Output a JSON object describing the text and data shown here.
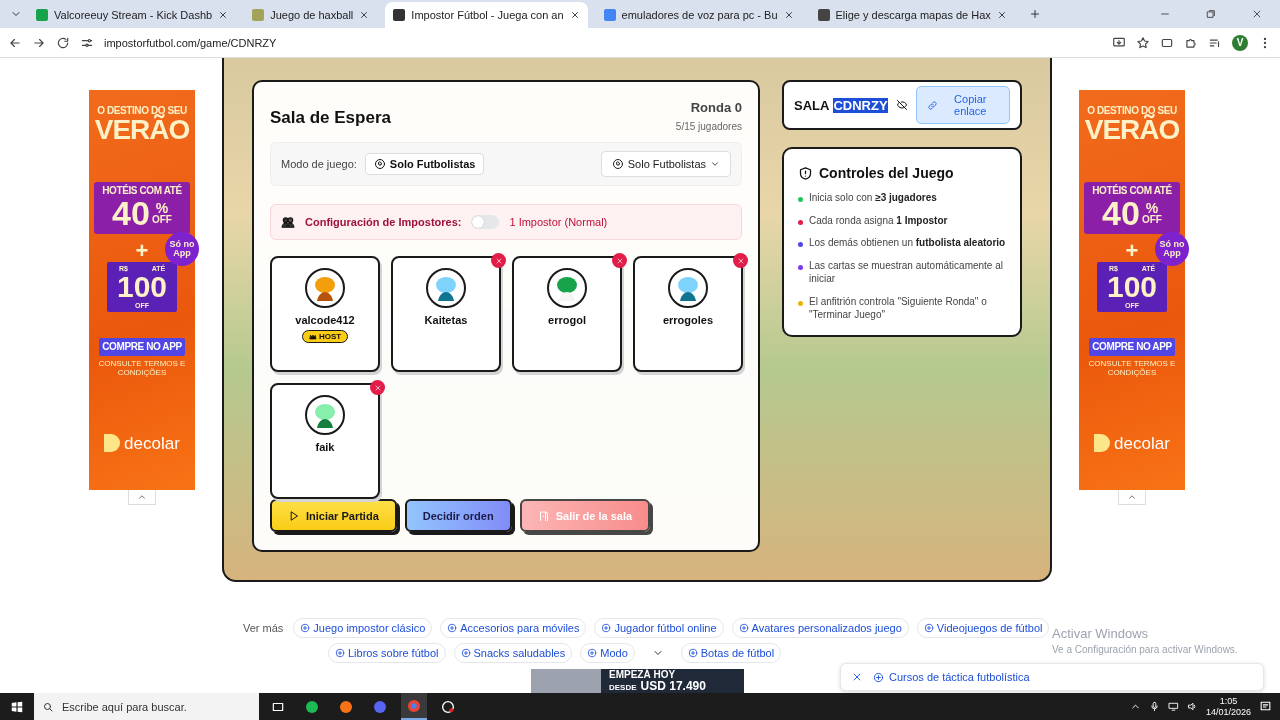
{
  "browser": {
    "tabs": [
      {
        "title": "Valcoreeuy Stream - Kick Dashb",
        "selected": false
      },
      {
        "title": "Juego de haxball",
        "selected": false
      },
      {
        "title": "Impostor Fútbol - Juega con an",
        "selected": true
      },
      {
        "title": "emuladores de voz para pc - Bu",
        "selected": false
      },
      {
        "title": "Elige y descarga mapas de Hax",
        "selected": false
      }
    ],
    "address": "impostorfutbol.com/game/CDNRZY",
    "profile_initial": "V"
  },
  "ads": [
    {
      "headline": "O DESTINO DO SEU",
      "big": "VERÃO",
      "offer": "HOTÉIS COM ATÉ",
      "percent": "40",
      "percent_sign": "%",
      "off": "OFF",
      "plus": "+",
      "currency": "R$",
      "upto": "ATÉ",
      "amount": "100",
      "off2": "OFF",
      "app_badge": "Só no App",
      "cta": "COMPRE NO APP",
      "terms": "CONSULTE TERMOS E CONDIÇÕES",
      "brand": "decolar"
    },
    {
      "headline": "O DESTINO DO SEU",
      "big": "VERÃO",
      "offer": "HOTÉIS COM ATÉ",
      "percent": "40",
      "percent_sign": "%",
      "off": "OFF",
      "plus": "+",
      "currency": "R$",
      "upto": "ATÉ",
      "amount": "100",
      "off2": "OFF",
      "app_badge": "Só no App",
      "cta": "COMPRE NO APP",
      "terms": "CONSULTE TERMOS E CONDIÇÕES",
      "brand": "decolar"
    }
  ],
  "waiting_room": {
    "title": "Sala de Espera",
    "round": "Ronda 0",
    "players_count": "5/15 jugadores",
    "mode_label": "Modo de juego:",
    "mode_chip": "Solo Futbolistas",
    "mode_select": "Solo Futbolistas",
    "impostor_label": "Configuración de Impostores:",
    "impostor_toggle": {
      "on": false
    },
    "impostor_value": "1 Impostor (Normal)",
    "players": [
      {
        "name": "valcode412",
        "badge": "HOST",
        "removable": false
      },
      {
        "name": "Kaitetas",
        "removable": true
      },
      {
        "name": "errogol",
        "removable": true
      },
      {
        "name": "errogoles",
        "removable": true
      },
      {
        "name": "faik",
        "removable": true
      }
    ],
    "buttons": [
      {
        "label": "Iniciar Partida",
        "kind": "start"
      },
      {
        "label": "Decidir orden",
        "kind": "order"
      },
      {
        "label": "Salir de la sala",
        "kind": "leave"
      }
    ]
  },
  "room_code": {
    "label": "SALA",
    "code": "CDNRZY",
    "highlighted": true,
    "copy_button": "Copiar enlace"
  },
  "controls": {
    "title": "Controles del Juego",
    "items": [
      {
        "text": "Inicia solo con  **≥3 jugadores**",
        "color": "#22c55e"
      },
      {
        "text": "Cada ronda asigna  **1 Impostor**",
        "color": "#e11d48"
      },
      {
        "text": "Los demás obtienen un  **futbolista aleatorio**",
        "color": "#4f46e5"
      },
      {
        "text": "Las cartas se muestran automáticamente al iniciar",
        "color": "#7c3aed"
      },
      {
        "text": "El anfitrión controla \"Siguiente Ronda\" o \"Terminar Juego\"",
        "color": "#eab308"
      }
    ]
  },
  "more": {
    "label": "Ver más",
    "rows": [
      {
        "chips": [
          "Juego impostor clásico",
          "Accesorios para móviles",
          "Jugador fútbol online",
          "Avatares personalizados juego",
          "Videojuegos de fútbol"
        ]
      },
      {
        "chips": [
          "Libros sobre fútbol",
          "Snacks saludables",
          "Modo",
          "Botas de fútbol"
        ]
      }
    ]
  },
  "bottom_ad": {
    "headline": "EMPEZÁ HOY",
    "from": "DESDE",
    "price": "USD 17.490"
  },
  "toast": {
    "text": "Cursos de táctica futbolística"
  },
  "activation": {
    "title": "Activar Windows",
    "subtitle": "Ve a Configuración para activar Windows."
  },
  "taskbar": {
    "search_placeholder": "Escribe aquí para buscar.",
    "time": "1:05",
    "date": "14/01/2026"
  }
}
